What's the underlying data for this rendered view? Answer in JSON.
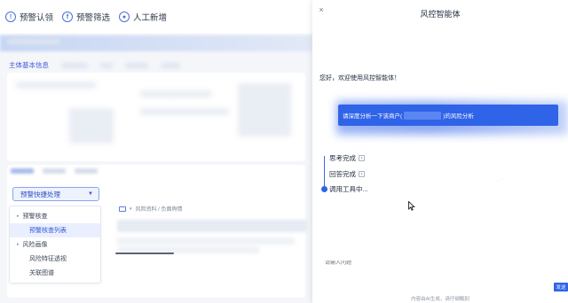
{
  "toolbar": {
    "buttons": [
      {
        "label": "预警认领",
        "icon": "bell-icon"
      },
      {
        "label": "预警筛选",
        "icon": "filter-icon"
      },
      {
        "label": "人工新增",
        "icon": "user-icon"
      }
    ]
  },
  "section": {
    "title": "主体基本信息"
  },
  "dropdown": {
    "label": "预警快捷处理"
  },
  "menu": {
    "items": [
      {
        "label": "预警核查",
        "level": 0
      },
      {
        "label": "预警核查列表",
        "level": 1,
        "selected": true
      },
      {
        "label": "风险画像",
        "level": 0
      },
      {
        "label": "风险特征透视",
        "level": 1
      },
      {
        "label": "关联图谱",
        "level": 1
      }
    ]
  },
  "breadcrumb": {
    "text": "风险资料 / 负面舆情"
  },
  "drawer": {
    "close_icon": "×",
    "title": "风控智能体",
    "greeting": "您好，欢迎使用风控智能体！",
    "user_message_prefix": "请深度分析一下该商户(",
    "user_message_suffix": ")的风险分析",
    "steps": [
      {
        "label": "思考完成"
      },
      {
        "label": "回答完成"
      },
      {
        "label": "调用工具中..."
      }
    ],
    "input_placeholder": "请输入问题",
    "send_label": "发送",
    "footer": "内容由AI生成，请仔细甄别"
  },
  "colors": {
    "accent": "#2f63e8",
    "selected_bg": "#e9efff"
  }
}
